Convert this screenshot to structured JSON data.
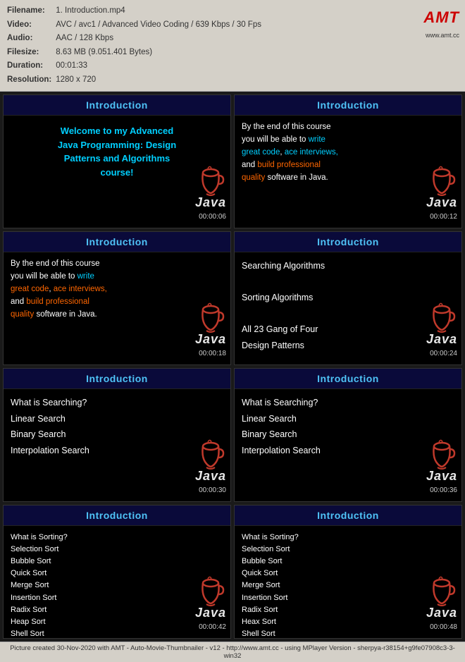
{
  "fileinfo": {
    "filename_label": "Filename:",
    "filename_value": "1. Introduction.mp4",
    "video_label": "Video:",
    "video_value": "AVC / avc1 / Advanced Video Coding / 639 Kbps / 30 Fps",
    "audio_label": "Audio:",
    "audio_value": "AAC / 128 Kbps",
    "filesize_label": "Filesize:",
    "filesize_value": "8.63 MB (9.051.401 Bytes)",
    "duration_label": "Duration:",
    "duration_value": "00:01:33",
    "resolution_label": "Resolution:",
    "resolution_value": "1280 x 720",
    "amt_brand": "AMT",
    "amt_url": "www.amt.cc"
  },
  "thumbnails": [
    {
      "title": "Introduction",
      "type": "welcome",
      "timestamp": "00:00:06",
      "lines": [
        {
          "text": "Welcome to my Advanced",
          "color": "cyan"
        },
        {
          "text": "Java Programming: Design",
          "color": "cyan"
        },
        {
          "text": "Patterns and Algorithms",
          "color": "cyan"
        },
        {
          "text": "course!",
          "color": "cyan"
        }
      ]
    },
    {
      "title": "Introduction",
      "type": "byend",
      "timestamp": "00:00:12",
      "lines": [
        {
          "text": "By the end of this course",
          "color": "white"
        },
        {
          "text": "you will be able to ",
          "color": "white",
          "highlight": "write"
        },
        {
          "text": "great code",
          "color": "orange",
          "cont": ", ace interviews,"
        },
        {
          "text": "and ",
          "color": "white",
          "highlight2": "build professional"
        },
        {
          "text": "quality",
          "color": "orange",
          "cont": " software in Java."
        }
      ]
    },
    {
      "title": "Introduction",
      "type": "byend2",
      "timestamp": "00:00:18",
      "lines": [
        {
          "text": "By the end of this course",
          "color": "white"
        },
        {
          "text": "you will be able to write",
          "color": "white"
        },
        {
          "text": "great code, ace interviews,",
          "color": "orange"
        },
        {
          "text": "and build professional",
          "color": "orange"
        },
        {
          "text": "quality software in Java.",
          "color": "orange"
        }
      ]
    },
    {
      "title": "Introduction",
      "type": "topics1",
      "timestamp": "00:00:24",
      "lines": [
        {
          "text": "Searching Algorithms",
          "color": "white"
        },
        {
          "text": "",
          "color": "white"
        },
        {
          "text": "Sorting Algorithms",
          "color": "white"
        },
        {
          "text": "",
          "color": "white"
        },
        {
          "text": "All 23 Gang of Four",
          "color": "white"
        },
        {
          "text": "Design Patterns",
          "color": "white"
        }
      ]
    },
    {
      "title": "Introduction",
      "type": "searching",
      "timestamp": "00:00:30",
      "lines": [
        {
          "text": "What is Searching?",
          "color": "white"
        },
        {
          "text": "Linear Search",
          "color": "white"
        },
        {
          "text": "Binary Search",
          "color": "white"
        },
        {
          "text": "Interpolation Search",
          "color": "white"
        }
      ]
    },
    {
      "title": "Introduction",
      "type": "searching2",
      "timestamp": "00:00:36",
      "lines": [
        {
          "text": "What is Searching?",
          "color": "white"
        },
        {
          "text": "Linear Search",
          "color": "white"
        },
        {
          "text": "Binary Search",
          "color": "white"
        },
        {
          "text": "Interpolation Search",
          "color": "white"
        }
      ]
    },
    {
      "title": "Introduction",
      "type": "sorting",
      "timestamp": "00:00:42",
      "lines": [
        {
          "text": "What is Sorting?",
          "color": "white"
        },
        {
          "text": "Selection Sort",
          "color": "white"
        },
        {
          "text": "Bubble Sort",
          "color": "white"
        },
        {
          "text": "Quick Sort",
          "color": "white"
        },
        {
          "text": "Merge Sort",
          "color": "white"
        },
        {
          "text": "Insertion Sort",
          "color": "white"
        },
        {
          "text": "Radix Sort",
          "color": "white"
        },
        {
          "text": "Heap Sort",
          "color": "white"
        },
        {
          "text": "Shell Sort",
          "color": "white"
        }
      ]
    },
    {
      "title": "Introduction",
      "type": "sorting2",
      "timestamp": "00:00:48",
      "lines": [
        {
          "text": "What is Sorting?",
          "color": "white"
        },
        {
          "text": "Selection Sort",
          "color": "white"
        },
        {
          "text": "Bubble Sort",
          "color": "white"
        },
        {
          "text": "Quick Sort",
          "color": "white"
        },
        {
          "text": "Merge Sort",
          "color": "white"
        },
        {
          "text": "Insertion Sort",
          "color": "white"
        },
        {
          "text": "Radix Sort",
          "color": "white"
        },
        {
          "text": "Heax Sort",
          "color": "white"
        },
        {
          "text": "Shell Sort",
          "color": "white"
        }
      ]
    }
  ],
  "footer": {
    "text": "Picture created 30-Nov-2020 with AMT - Auto-Movie-Thumbnailer - v12 - http://www.amt.cc - using MPlayer Version - sherpya-r38154+g9fe07908c3-3-win32"
  }
}
